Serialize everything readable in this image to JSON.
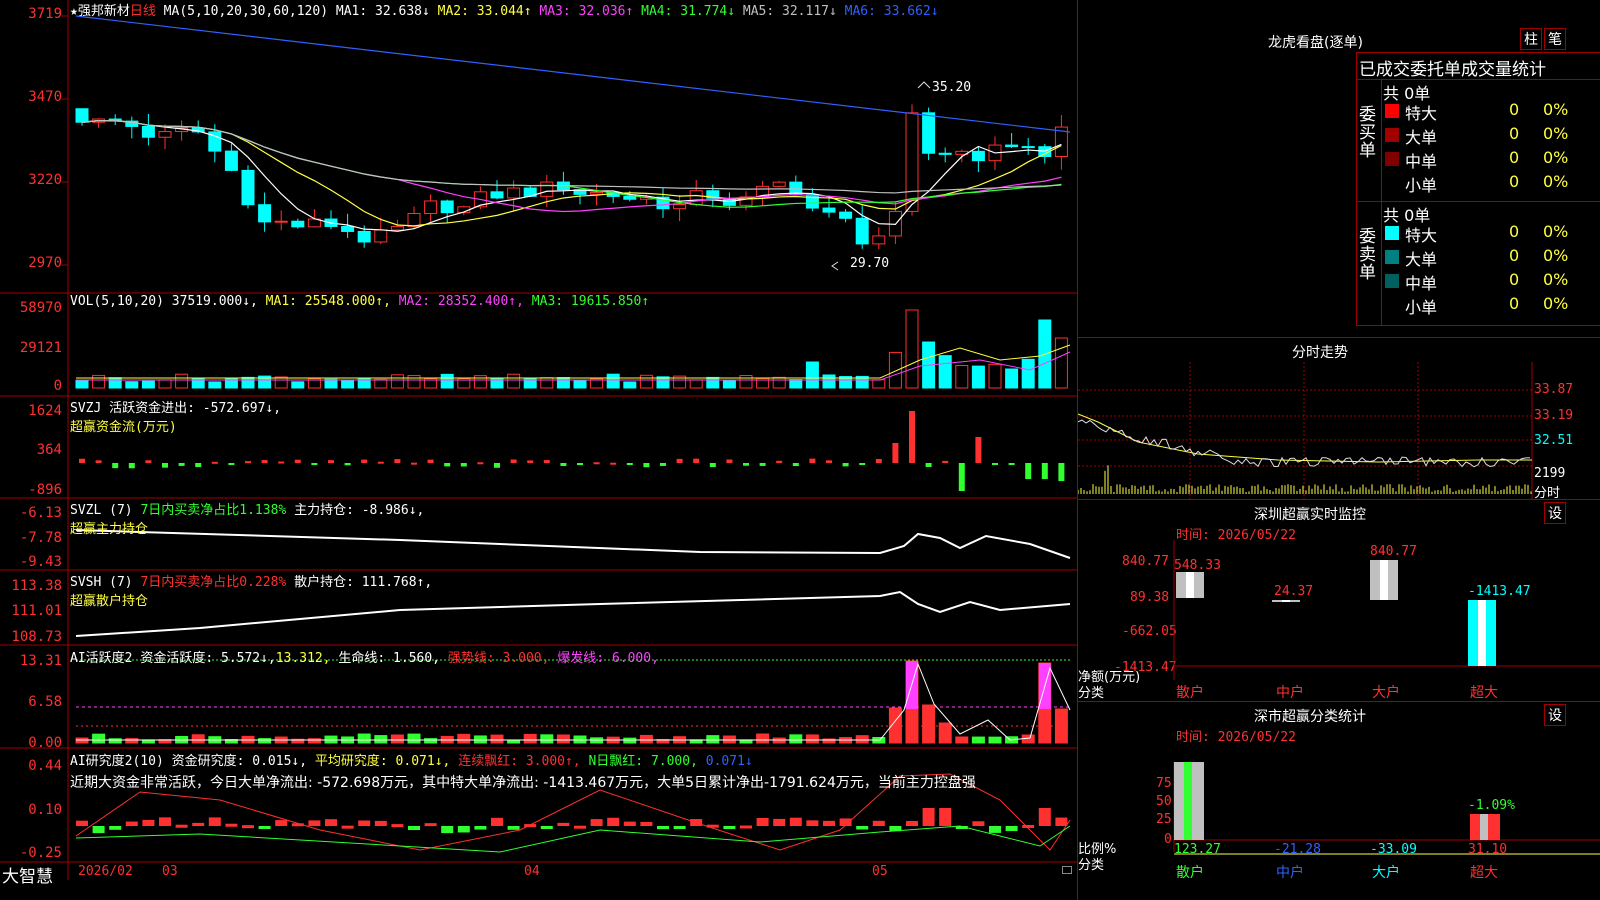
{
  "colors": {
    "up": "#ff3030",
    "down": "#00ffff",
    "ma1": "#ffffff",
    "ma2": "#ffff40",
    "ma3": "#ff40ff",
    "ma4": "#30ff30",
    "ma5": "#c0c0c0",
    "ma6": "#3060ff",
    "grid": "#a00000"
  },
  "price": {
    "title": "★强邦新材",
    "period": "日线",
    "ma_params": "MA(5,10,20,30,60,120)",
    "ma1": "MA1: 32.638↓",
    "ma2": "MA2: 33.044↑",
    "ma3": "MA3: 32.036↑",
    "ma4": "MA4: 31.774↓",
    "ma5": "MA5: 32.117↓",
    "ma6": "MA6: 33.662↓",
    "yticks": [
      "3719",
      "3470",
      "3220",
      "2970"
    ],
    "high_note": "35.20",
    "low_note": "29.70"
  },
  "vol": {
    "label": "VOL(5,10,20)",
    "value": "37519.000↓,",
    "ma1": "MA1: 25548.000↑,",
    "ma2": "MA2: 28352.400↑,",
    "ma3": "MA3: 19615.850↑",
    "yticks": [
      "58970",
      "29121",
      "0"
    ]
  },
  "svzj": {
    "label": "SVZJ  活跃资金进出: -572.697↓,",
    "name": "超赢资金流(万元)",
    "yticks": [
      "1624",
      "364",
      "-896"
    ]
  },
  "svzl": {
    "label": "SVZL (7)",
    "ratio": "7日内买卖净占比1.138%",
    "hold": "主力持仓: -8.986↓,",
    "name": "超赢主力持仓",
    "yticks": [
      "-6.13",
      "-7.78",
      "-9.43"
    ]
  },
  "svsh": {
    "label": "SVSH (7)",
    "ratio": "7日内买卖净占比0.228%",
    "hold": "散户持仓: 111.768↑,",
    "name": "超赢散户持仓",
    "yticks": [
      "113.38",
      "111.01",
      "108.73"
    ]
  },
  "ai1": {
    "label": "AI活跃度2",
    "v1": "资金活跃度: 5.572↓,",
    "v2": "13.312,",
    "v3": "生命线: 1.560,",
    "v4": "强势线: 3.000,",
    "v5": "爆发线: 6.000,",
    "yticks": [
      "13.31",
      "6.58",
      "0.00"
    ]
  },
  "ai2": {
    "label": "AI研究度2(10)",
    "v1": "资金研究度: 0.015↓,",
    "v2": "平均研究度: 0.071↓,",
    "v3": "连续飘红: 3.000↑,",
    "v4": "N日飘红: 7.000,",
    "v5": "0.071↓",
    "summary": "近期大资金非常活跃，今日大单净流出: -572.698万元，其中特大单净流出: -1413.467万元，大单5日累计净出-1791.624万元，当前主力控盘强",
    "yticks": [
      "0.44",
      "0.10",
      "-0.25"
    ]
  },
  "xaxis": {
    "brand": "大智慧",
    "labels": [
      "2026/02",
      "03",
      "04",
      "05"
    ]
  },
  "dragon": {
    "title": "龙虎看盘(逐单)",
    "btn1": "柱",
    "btn2": "笔",
    "subtitle": "已成交委托单成交量统计",
    "buy": {
      "side": "委买单",
      "total": "共 0单",
      "rows": [
        {
          "name": "特大",
          "count": "0",
          "pct": "0%",
          "color": "#ff0000"
        },
        {
          "name": "大单",
          "count": "0",
          "pct": "0%",
          "color": "#a00000"
        },
        {
          "name": "中单",
          "count": "0",
          "pct": "0%",
          "color": "#800000"
        },
        {
          "name": "小单",
          "count": "0",
          "pct": "0%",
          "color": ""
        }
      ]
    },
    "sell": {
      "side": "委卖单",
      "total": "共 0单",
      "rows": [
        {
          "name": "特大",
          "count": "0",
          "pct": "0%",
          "color": "#00ffff"
        },
        {
          "name": "大单",
          "count": "0",
          "pct": "0%",
          "color": "#008080"
        },
        {
          "name": "中单",
          "count": "0",
          "pct": "0%",
          "color": "#006060"
        },
        {
          "name": "小单",
          "count": "0",
          "pct": "0%",
          "color": ""
        }
      ]
    }
  },
  "intraday": {
    "title": "分时走势",
    "yticks": [
      "33.87",
      "33.19",
      "32.51",
      "2199"
    ],
    "unit": "分时"
  },
  "monitor": {
    "title": "深圳超赢实时监控",
    "btn": "设",
    "time": "时间: 2026/05/22",
    "yticks": [
      "840.77",
      "89.38",
      "-662.05",
      "-1413.47"
    ],
    "ylabel1": "净额(万元)",
    "ylabel2": "分类",
    "values": [
      "548.33",
      "24.37",
      "840.77",
      "-1413.47"
    ],
    "cats": [
      "散户",
      "中户",
      "大户",
      "超大"
    ]
  },
  "classify": {
    "title": "深市超赢分类统计",
    "btn": "设",
    "time": "时间: 2026/05/22",
    "yticks": [
      "75",
      "50",
      "25",
      "0"
    ],
    "ylabel1": "比例%",
    "ylabel2": "分类",
    "values": [
      "123.27",
      "-21.28",
      "-33.09",
      "31.10"
    ],
    "top_note": "-1.09%",
    "cats": [
      "散户",
      "中户",
      "大户",
      "超大"
    ]
  }
}
